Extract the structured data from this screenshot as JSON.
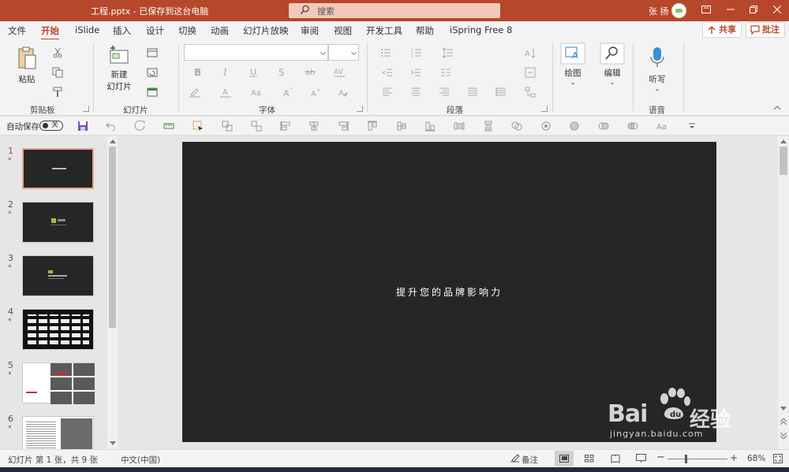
{
  "titlebar": {
    "document": "工程.pptx - 已保存到这台电脑",
    "search_label": "搜索",
    "user_name": "张 扬"
  },
  "menu": {
    "tabs": [
      "文件",
      "开始",
      "iSlide",
      "插入",
      "设计",
      "切换",
      "动画",
      "幻灯片放映",
      "审阅",
      "视图",
      "开发工具",
      "帮助",
      "iSpring Free 8"
    ],
    "active": "开始",
    "share_label": "共享",
    "comment_label": "批注"
  },
  "ribbon": {
    "paste_label": "粘贴",
    "clipboard_group": "剪贴板",
    "new_slide_label_1": "新建",
    "new_slide_label_2": "幻灯片",
    "slides_group": "幻灯片",
    "font_group": "字体",
    "paragraph_group": "段落",
    "draw_label": "绘图",
    "edit_label": "编辑",
    "dictate_label": "听写",
    "voice_group": "语音",
    "font_name": "",
    "font_size": ""
  },
  "qat": {
    "autosave_label": "自动保存",
    "autosave_state": "关"
  },
  "thumbnails": [
    {
      "num": "1",
      "star": "*"
    },
    {
      "num": "2",
      "star": "*"
    },
    {
      "num": "3",
      "star": "*"
    },
    {
      "num": "4",
      "star": "*"
    },
    {
      "num": "5",
      "star": "*"
    },
    {
      "num": "6",
      "star": "*"
    }
  ],
  "slide": {
    "title": "提升您的品牌影响力"
  },
  "status": {
    "slide_info": "幻灯片 第 1 张，共 9 张",
    "language": "中文(中国)",
    "notes_label": "备注",
    "zoom": "68%"
  },
  "watermark": {
    "brand": "Bai",
    "suffix": "经验",
    "url": "jingyan.baidu.com"
  },
  "colors": {
    "accent": "#b7472a",
    "slide_bg": "#262626"
  }
}
